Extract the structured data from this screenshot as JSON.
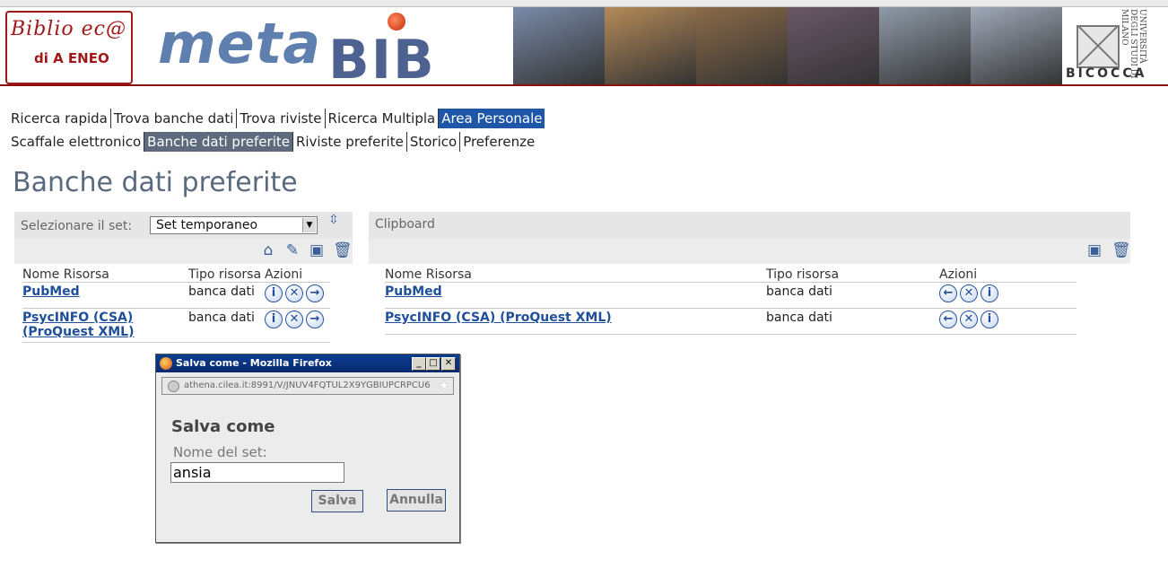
{
  "banner": {
    "logo_line1": "Biblio ec@",
    "logo_line2": "di A ENEO",
    "brand_meta": "meta",
    "brand_bib": "BIB",
    "univ_text": "UNIVERSITÀ DEGLI STUDI DI MILANO",
    "univ_name": "BICOCCA",
    "photo_colors": [
      "#7a8aa8",
      "#b48a58",
      "#8a6a48",
      "#6a5868",
      "#8f9aa8",
      "#a0a8b8"
    ]
  },
  "nav_primary": [
    {
      "label": "Ricerca rapida"
    },
    {
      "label": "Trova banche dati"
    },
    {
      "label": "Trova riviste"
    },
    {
      "label": "Ricerca Multipla"
    },
    {
      "label": "Area Personale",
      "active": true
    }
  ],
  "nav_secondary": [
    {
      "label": "Scaffale elettronico"
    },
    {
      "label": "Banche dati preferite",
      "active": true
    },
    {
      "label": "Riviste preferite"
    },
    {
      "label": "Storico"
    },
    {
      "label": "Preferenze"
    }
  ],
  "page_title": "Banche dati preferite",
  "left_panel": {
    "set_label": "Selezionare il set:",
    "set_value": "Set temporaneo",
    "toolbar_icons": [
      "new-folder-icon",
      "tag-icon",
      "save-disk-icon",
      "trash-icon"
    ],
    "columns": [
      "Nome Risorsa",
      "Tipo risorsa",
      "Azioni"
    ],
    "rows": [
      {
        "name": "PubMed",
        "type": "banca dati"
      },
      {
        "name": "PsycINFO (CSA) (ProQuest XML)",
        "type": "banca dati"
      }
    ],
    "row_actions": [
      "info-icon",
      "remove-icon",
      "arrow-right-icon"
    ]
  },
  "right_panel": {
    "title": "Clipboard",
    "toolbar_icons": [
      "save-disk-icon",
      "trash-icon"
    ],
    "columns": [
      "Nome Risorsa",
      "Tipo risorsa",
      "Azioni"
    ],
    "rows": [
      {
        "name": "PubMed",
        "type": "banca dati"
      },
      {
        "name": "PsycINFO (CSA) (ProQuest XML)",
        "type": "banca dati"
      }
    ],
    "row_actions": [
      "arrow-left-icon",
      "remove-icon",
      "info-icon"
    ]
  },
  "dialog": {
    "window_title": "Salva come - Mozilla Firefox",
    "url": "athena.cilea.it:8991/V/JNUV4FQTUL2X9YGBIUPCRPCU6",
    "heading": "Salva come",
    "field_label": "Nome del set:",
    "field_value": "ansia",
    "save_label": "Salva",
    "cancel_label": "Annulla"
  }
}
